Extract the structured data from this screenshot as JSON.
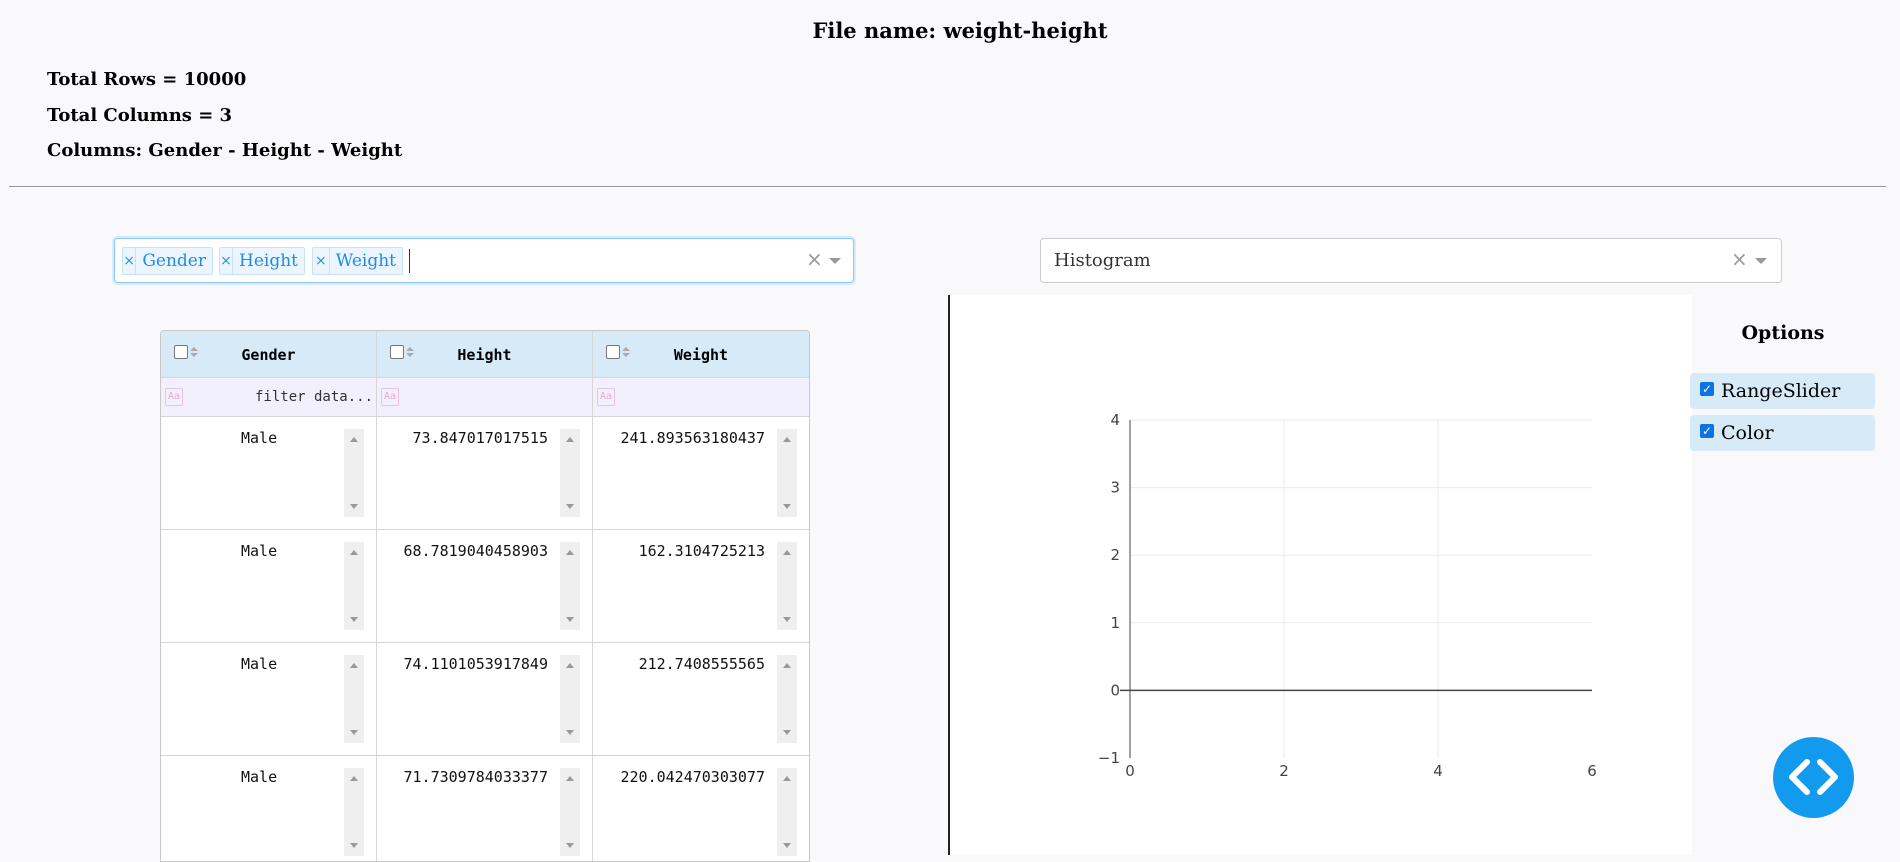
{
  "header": {
    "file_name": "File name: weight-height",
    "total_rows": "Total Rows = 10000",
    "total_columns": "Total Columns = 3",
    "columns": "Columns: Gender - Height - Weight"
  },
  "column_select": {
    "tags": [
      "Gender",
      "Height",
      "Weight"
    ],
    "remove_symbol": "×",
    "clear_symbol": "×"
  },
  "chart_type_select": {
    "value": "Histogram",
    "clear_symbol": "×"
  },
  "table": {
    "columns": [
      "Gender",
      "Height",
      "Weight"
    ],
    "filter_placeholder": "filter data...",
    "rows": [
      [
        "Male",
        "73.847017017515",
        "241.893563180437"
      ],
      [
        "Male",
        "68.7819040458903",
        "162.3104725213"
      ],
      [
        "Male",
        "74.1101053917849",
        "212.7408555565"
      ],
      [
        "Male",
        "71.7309784033377",
        "220.042470303077"
      ]
    ]
  },
  "chart_data": {
    "type": "bar",
    "title": "",
    "x_ticks": [
      "0",
      "2",
      "4",
      "6"
    ],
    "y_ticks": [
      "4",
      "3",
      "2",
      "1",
      "0",
      "−1"
    ],
    "xlim": [
      0,
      6
    ],
    "ylim": [
      -1,
      4
    ],
    "series": []
  },
  "options": {
    "title": "Options",
    "items": [
      {
        "label": "RangeSlider",
        "checked": true
      },
      {
        "label": "Color",
        "checked": true
      }
    ]
  },
  "colors": {
    "accent": "#129aef",
    "tag_text": "#1f8ce6",
    "header_bg": "#d6eaf8"
  },
  "fab_icon": "code-icon"
}
